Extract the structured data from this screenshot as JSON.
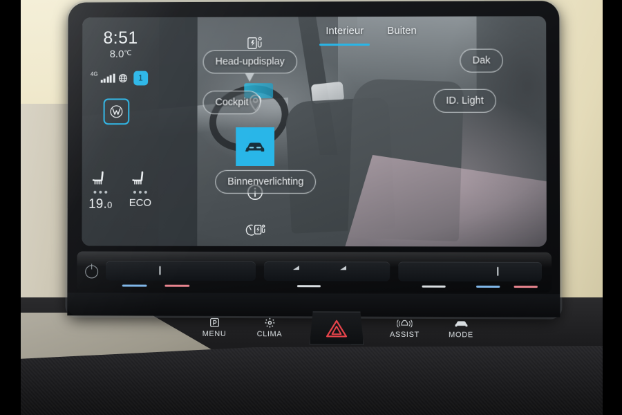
{
  "device": {
    "name": "Volkswagen ID. infotainment head unit",
    "accent_color": "#29b6e8",
    "screen_bg": "#3d4347"
  },
  "status_bar": {
    "time": "8:51",
    "outside_temperature": "8.0",
    "temperature_unit": "℃",
    "network_type": "4G",
    "globe_icon": "globe-icon",
    "signal_icon": "signal-bars-icon",
    "sim_badge": "1",
    "brand_logo": "vw-logo-icon"
  },
  "climate_bar": {
    "left": {
      "icon": "seat-heating-icon",
      "level_dots": 3,
      "value": "19.",
      "value_decimal": "0"
    },
    "right": {
      "icon": "seat-heating-icon",
      "level_dots": 3,
      "value": "ECO"
    }
  },
  "side_rail": {
    "items": [
      {
        "icon": "charging-battery-icon",
        "label": "Charging",
        "active": false
      },
      {
        "icon": "location-pin-icon",
        "label": "Navigation",
        "active": false
      },
      {
        "icon": "car-front-icon",
        "label": "Vehicle",
        "active": true
      },
      {
        "icon": "info-circle-icon",
        "label": "Information",
        "active": false
      },
      {
        "icon": "charge-timer-icon",
        "label": "Charge timer",
        "active": false
      }
    ]
  },
  "tabs": [
    {
      "label": "Interieur",
      "active": true
    },
    {
      "label": "Buiten",
      "active": false
    }
  ],
  "hotspots": [
    {
      "id": "hud",
      "label": "Head-updisplay",
      "has_pointer": true
    },
    {
      "id": "cockpit",
      "label": "Cockpit",
      "has_pointer": false
    },
    {
      "id": "interior-light",
      "label": "Binnenverlichting",
      "has_pointer": false
    },
    {
      "id": "roof",
      "label": "Dak",
      "has_pointer": false
    },
    {
      "id": "id-light",
      "label": "ID. Light",
      "has_pointer": false
    }
  ],
  "control_strip": {
    "power_icon": "power-icon",
    "left_slider": {
      "name": "driver-temperature-slider",
      "cold_color": "#7fb6e8",
      "warm_color": "#e8848e"
    },
    "center_slider": {
      "name": "volume-slider",
      "indicator_color": "#d8dde0"
    },
    "right_slider": {
      "name": "passenger-temperature-slider",
      "cold_color": "#7fb6e8",
      "warm_color": "#e8848e"
    }
  },
  "hard_keys": [
    {
      "id": "menu",
      "label": "MENU",
      "icon": "park-p-icon"
    },
    {
      "id": "clima",
      "label": "CLIMA",
      "icon": "fan-gear-icon"
    },
    {
      "id": "hazard",
      "label": "",
      "icon": "hazard-triangle-icon",
      "color": "#e8444b"
    },
    {
      "id": "assist",
      "label": "ASSIST",
      "icon": "car-assist-icon"
    },
    {
      "id": "mode",
      "label": "MODE",
      "icon": "car-mode-icon"
    }
  ]
}
